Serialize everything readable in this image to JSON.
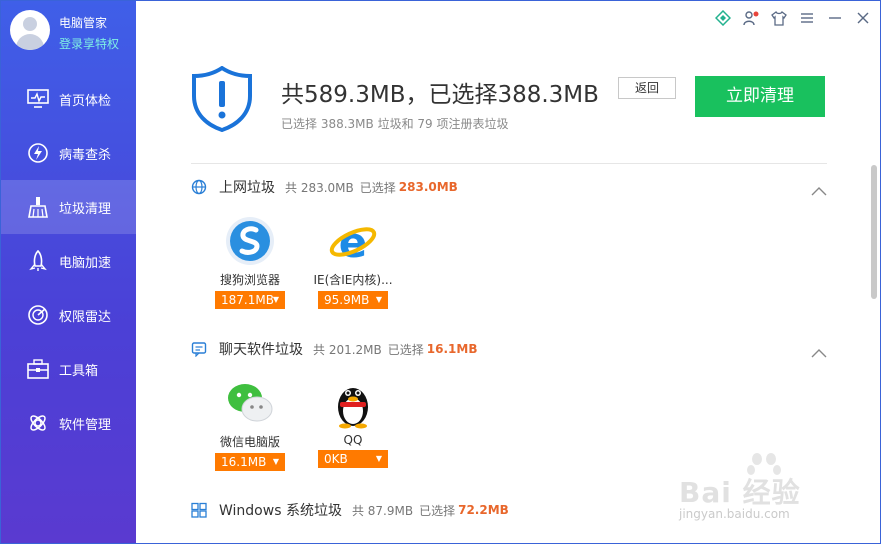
{
  "sidebar": {
    "app_name": "电脑管家",
    "login_link": "登录享特权",
    "items": [
      {
        "label": "首页体检",
        "icon": "monitor-icon",
        "active": false
      },
      {
        "label": "病毒查杀",
        "icon": "lightning-shield-icon",
        "active": false
      },
      {
        "label": "垃圾清理",
        "icon": "broom-icon",
        "active": true
      },
      {
        "label": "电脑加速",
        "icon": "rocket-icon",
        "active": false
      },
      {
        "label": "权限雷达",
        "icon": "radar-icon",
        "active": false
      },
      {
        "label": "工具箱",
        "icon": "toolbox-icon",
        "active": false
      },
      {
        "label": "软件管理",
        "icon": "apps-icon",
        "active": false
      }
    ]
  },
  "titlebar": {
    "buttons": [
      "diamond-icon",
      "user-settings-icon",
      "shirt-icon",
      "menu-icon",
      "minimize-icon",
      "close-icon"
    ]
  },
  "summary": {
    "headline": "共589.3MB，已选择388.3MB",
    "subline": "已选择 388.3MB 垃圾和 79 项注册表垃圾",
    "back_label": "返回",
    "clean_label": "立即清理"
  },
  "sections": [
    {
      "title": "上网垃圾",
      "total": "共 283.0MB",
      "selected_label": "已选择",
      "selected_value": "283.0MB",
      "icon": "globe-icon",
      "apps": [
        {
          "name": "搜狗浏览器",
          "size": "187.1MB",
          "icon": "sogou-browser-icon"
        },
        {
          "name": "IE(含IE内核)...",
          "size": "95.9MB",
          "icon": "ie-browser-icon"
        }
      ]
    },
    {
      "title": "聊天软件垃圾",
      "total": "共 201.2MB",
      "selected_label": "已选择",
      "selected_value": "16.1MB",
      "icon": "chat-icon",
      "apps": [
        {
          "name": "微信电脑版",
          "size": "16.1MB",
          "icon": "wechat-icon"
        },
        {
          "name": "QQ",
          "size": "0KB",
          "icon": "qq-penguin-icon"
        }
      ]
    },
    {
      "title": "Windows 系统垃圾",
      "total": "共 87.9MB",
      "selected_label": "已选择",
      "selected_value": "72.2MB",
      "icon": "windows-icon"
    }
  ],
  "watermark": {
    "text": "Bai 经验",
    "url": "jingyan.baidu.com"
  },
  "colors": {
    "sidebar": "#4b4fe0",
    "accent_green": "#19c15e",
    "highlight_orange": "#e8672c",
    "size_badge": "#ff7a00",
    "shield_blue": "#1a73d9"
  }
}
